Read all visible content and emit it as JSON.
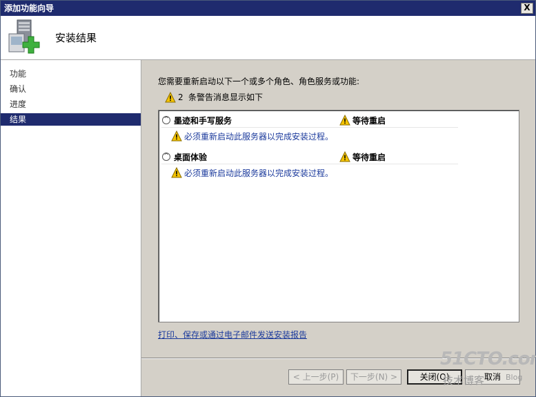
{
  "window": {
    "title": "添加功能向导",
    "close_label": "X"
  },
  "header": {
    "title": "安装结果"
  },
  "sidebar": {
    "items": [
      {
        "label": "功能",
        "active": false
      },
      {
        "label": "确认",
        "active": false
      },
      {
        "label": "进度",
        "active": false
      },
      {
        "label": "结果",
        "active": true
      }
    ]
  },
  "main": {
    "intro": "您需要重新启动以下一个或多个角色、角色服务或功能:",
    "warning_count": "2",
    "warning_text": "条警告消息显示如下",
    "groups": [
      {
        "name": "墨迹和手写服务",
        "status": "等待重启",
        "message": "必须重新启动此服务器以完成安装过程。"
      },
      {
        "name": "桌面体验",
        "status": "等待重启",
        "message": "必须重新启动此服务器以完成安装过程。"
      }
    ],
    "report_link": "打印、保存或通过电子邮件发送安装报告"
  },
  "buttons": {
    "prev": "< 上一步(P)",
    "next": "下一步(N) >",
    "close": "关闭(O)",
    "cancel": "取消"
  },
  "watermark": {
    "site": "51CTO.com",
    "blog_cn": "技术博客",
    "blog_en": "Blog"
  },
  "colors": {
    "title_bar": "#1f2b6e",
    "link": "#1b3a9c",
    "warning": "#f5c400"
  },
  "icons": {
    "header": "server-add-icon",
    "warning": "warning-icon",
    "collapse": "chevron-up-icon"
  }
}
